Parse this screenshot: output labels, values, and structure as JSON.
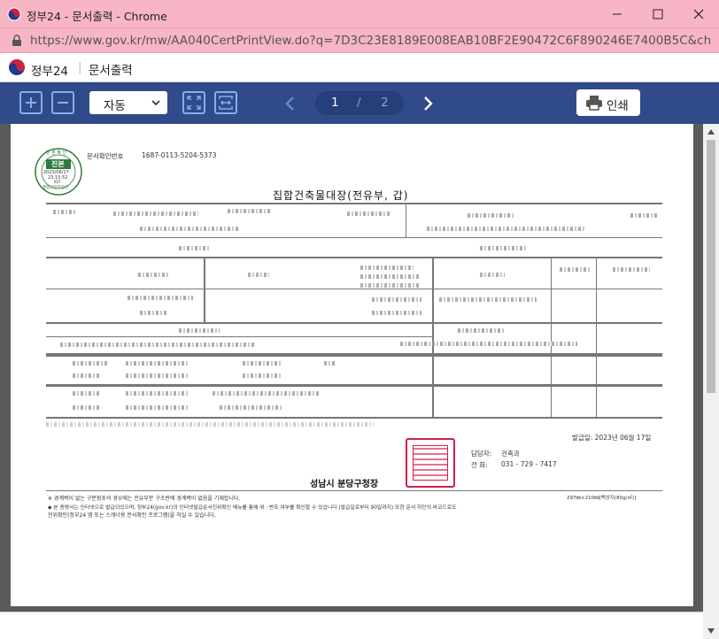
{
  "window": {
    "title": "정부24 - 문서출력 - Chrome",
    "url": "https://www.gov.kr/mw/AA040CertPrintView.do?q=7D3C23E8189E008EAB10BF2E90472C6F890246E7400B5C&charset..."
  },
  "header": {
    "brand": "정부24",
    "separator": "|",
    "page_title": "문서출력"
  },
  "toolbar": {
    "zoom_mode": "자동",
    "current_page": "1",
    "page_separator": "/",
    "total_pages": "2",
    "print_label": "인쇄"
  },
  "document": {
    "cert_number_label": "문서확인번호",
    "cert_number": "1687-0113-5204-5373",
    "seal_top": "진 본 확 인",
    "seal_center": "진본",
    "seal_date": "2023/06/17",
    "seal_time": "23:15:52",
    "seal_tz": "KST",
    "seal_bottom": "행정안전부장관",
    "title": "집합건축물대장(전유부, 갑)",
    "issue_date": "발급일: 2023년 06월 17일",
    "officer_label": "담당자:",
    "officer_dept": "건축과",
    "phone_label": "전  화:",
    "phone": "031 - 729 - 7417",
    "issuer": "성남시 분당구청장",
    "notes": [
      "※ 경계벽이 없는 구분점포의 경우에는 전유부분 구조란에 경계벽이 없음을 기재합니다.",
      "◆ 본 증명서는 인터넷으로 발급되었으며, 정부24(gov.kr)의 인터넷발급문서진위확인 메뉴를 통해 위ㆍ변조 여부를 확인할 수 있습니다.(발급일로부터 90일까지) 또한 문서 하단의 바코드로도",
      "   진위확인(정부24 앱 또는 스캐너용 문서확인 프로그램)을 하실 수 있습니다."
    ],
    "paper_size": "297㎜×210㎜[백상지(80g/㎡)]"
  },
  "colors": {
    "titlebar": "#f8b5c5",
    "toolbar": "#314a8a",
    "pager": "#263e7a",
    "icon_outline": "#7fb0ee",
    "seal_red": "#d0204a"
  }
}
